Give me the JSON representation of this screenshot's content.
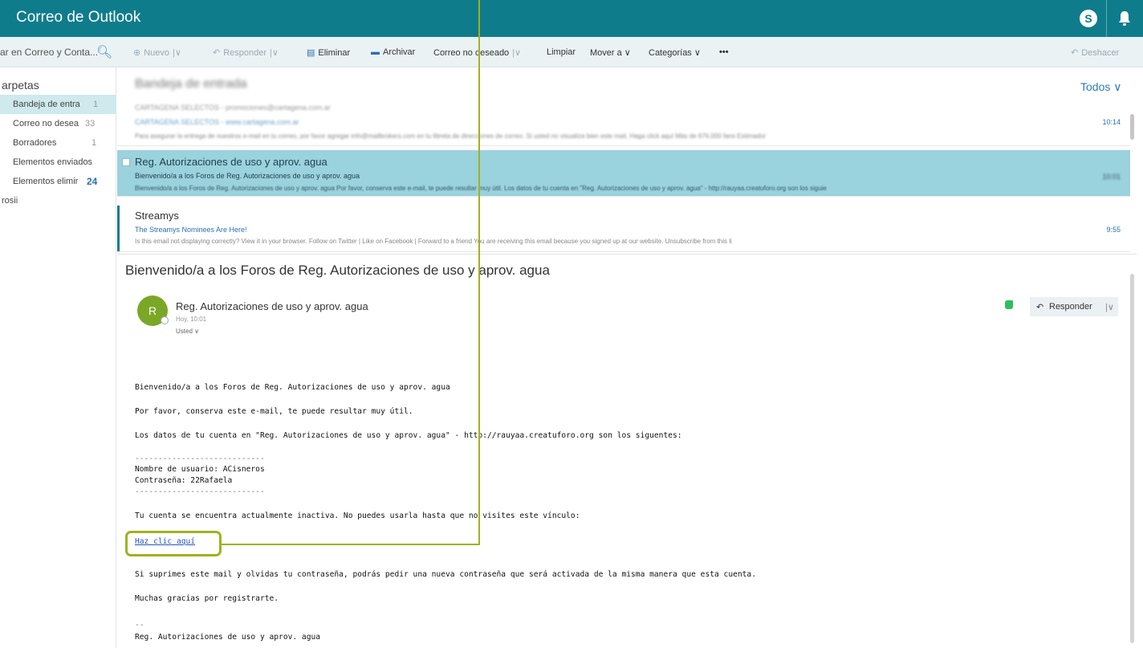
{
  "app": {
    "title": "Correo de Outlook"
  },
  "search": {
    "placeholder": "ar en Correo y Conta..."
  },
  "toolbar": {
    "new_label": "Nuevo",
    "reply_label": "Responder",
    "delete_label": "Eliminar",
    "archive_label": "Archivar",
    "junk_label": "Correo no deseado",
    "sweep_label": "Limpiar",
    "move_label": "Mover a",
    "categories_label": "Categorías",
    "more_label": "•••",
    "undo_label": "Deshacer"
  },
  "folders": {
    "header": "arpetas",
    "items": [
      {
        "label": "Bandeja de entra",
        "count": "1"
      },
      {
        "label": "Correo no desea",
        "count": "33"
      },
      {
        "label": "Borradores",
        "count": "1"
      },
      {
        "label": "Elementos enviados",
        "count": ""
      },
      {
        "label": "Elementos elimir",
        "count": "24"
      },
      {
        "label": "rosii",
        "count": ""
      }
    ]
  },
  "list": {
    "title": "Bandeja de entrada",
    "filter_label": "Todos",
    "messages": [
      {
        "from": "CARTAGENA SELECTOS - promociones@cartagena.com.ar",
        "subject": "CARTAGENA SELECTOS - www.cartagena.com.ar",
        "preview": "Para asegurar la entrega de nuestros e-mail en tu correo, por favor agregar info@mailbrokers.com en tu libreta de direcciones de correo. Si usted no visualiza bien este mail, Haga click aquí      Más de 676.000 fans    Estimado/",
        "time": "10:14"
      },
      {
        "from": "Reg. Autorizaciones de uso y aprov. agua",
        "subject": "Bienvenido/a a los Foros de Reg. Autorizaciones de uso y aprov. agua",
        "preview": "Bienvenido/a a los Foros de Reg. Autorizaciones de uso y aprov. agua  Por favor, conserva este e-mail, te puede resultar muy útil.  Los datos de tu cuenta en \"Reg. Autorizaciones de uso y aprov. agua\" - http://rauyaa.creatuforo.org son los siguie",
        "time": "10:01"
      },
      {
        "from": "Streamys",
        "subject": "The Streamys Nominees Are Here!",
        "preview": "Is this email not displaying correctly? View it in your browser.                    Follow on Twitter | Like on Facebook | Forward to a friend  You are receiving this email because you signed up at our website. Unsubscribe from this li",
        "time": "9:55"
      }
    ]
  },
  "reading": {
    "subject": "Bienvenido/a a los Foros de Reg. Autorizaciones de uso y aprov. agua",
    "avatar_letter": "R",
    "sender": "Reg. Autorizaciones de uso y aprov. agua",
    "date": "Hoy, 10:01",
    "to": "Usted",
    "reply_label": "Responder",
    "body": {
      "line1": "Bienvenido/a a los Foros de Reg. Autorizaciones de uso y aprov. agua",
      "line2": "Por favor, conserva este e-mail, te puede resultar muy útil.",
      "line3": "Los datos de tu cuenta en \"Reg. Autorizaciones de uso y aprov. agua\" - http://rauyaa.creatuforo.org son los siguentes:",
      "dashes": "----------------------------",
      "username": "Nombre de usuario: ACisneros",
      "password": "Contraseña: 22Rafaela",
      "line4": "Tu cuenta se encuentra actualmente inactiva. No puedes usarla hasta que no visites este vínculo:",
      "link": "Haz clic aquí",
      "line5": "Si suprimes este mail y olvidas tu contraseña, podrás pedir una nueva contraseña que será activada de la misma manera que esta cuenta.",
      "line6": "Muchas gracias por registrarte.",
      "sig_sep": "--",
      "signature": "Reg. Autorizaciones de uso y aprov. agua"
    }
  },
  "colors": {
    "brand": "#0f7c8c",
    "selected_row": "#9ad2de",
    "link": "#2553c6",
    "annotation": "#a0b21f"
  }
}
